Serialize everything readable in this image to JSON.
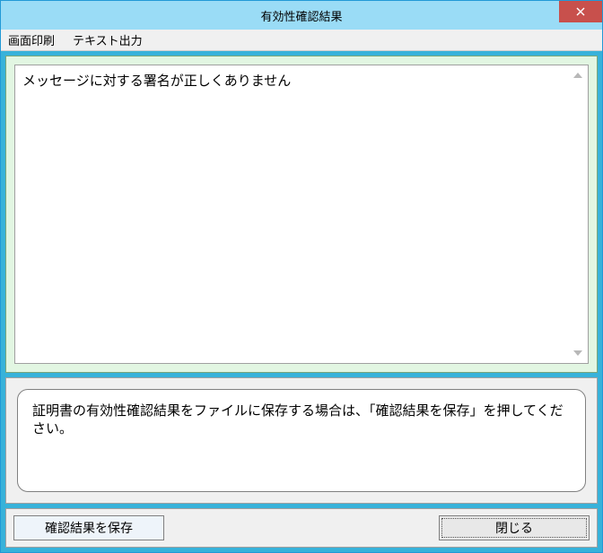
{
  "window": {
    "title": "有効性確認結果"
  },
  "menubar": {
    "items": [
      {
        "label": "画面印刷"
      },
      {
        "label": "テキスト出力"
      }
    ]
  },
  "message": {
    "text": "メッセージに対する署名が正しくありません"
  },
  "info": {
    "text": "証明書の有効性確認結果をファイルに保存する場合は、「確認結果を保存」を押してください。"
  },
  "buttons": {
    "save_label": "確認結果を保存",
    "close_label": "閉じる"
  },
  "colors": {
    "titlebar": "#9adcf6",
    "client": "#38b2da",
    "panel_top": "#e2f6e2",
    "close": "#c8504c"
  }
}
